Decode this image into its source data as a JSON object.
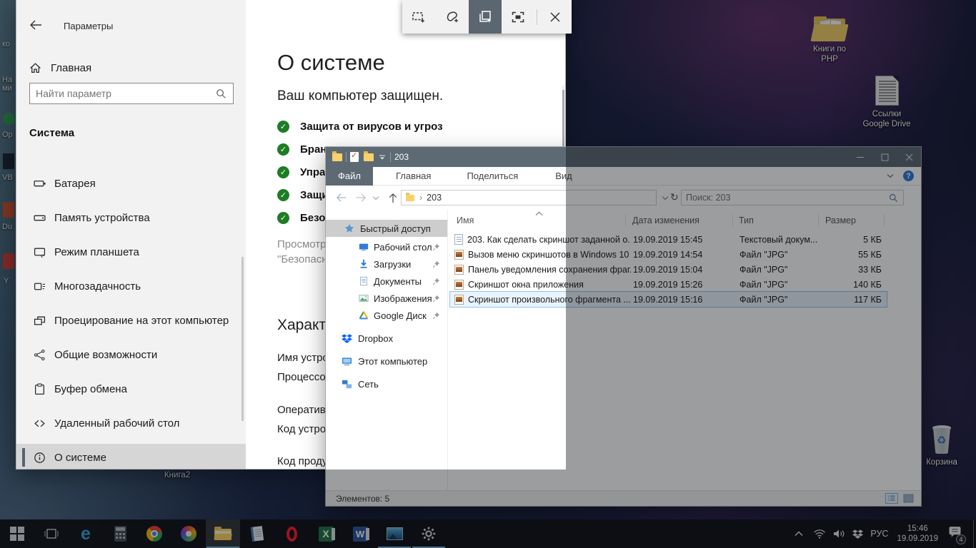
{
  "snip_toolbar": {
    "tools": [
      {
        "name": "rectangular-snip"
      },
      {
        "name": "freeform-snip"
      },
      {
        "name": "window-snip",
        "selected": true
      },
      {
        "name": "fullscreen-snip"
      }
    ]
  },
  "settings": {
    "window_title": "Параметры",
    "home_label": "Главная",
    "search_placeholder": "Найти параметр",
    "section_label": "Система",
    "nav_items": [
      {
        "icon": "battery-icon",
        "label": "Батарея"
      },
      {
        "icon": "storage-icon",
        "label": "Память устройства"
      },
      {
        "icon": "tablet-icon",
        "label": "Режим планшета"
      },
      {
        "icon": "multitasking-icon",
        "label": "Многозадачность"
      },
      {
        "icon": "projecting-icon",
        "label": "Проецирование на этот компьютер"
      },
      {
        "icon": "shared-experiences-icon",
        "label": "Общие возможности"
      },
      {
        "icon": "clipboard-icon",
        "label": "Буфер обмена"
      },
      {
        "icon": "remote-desktop-icon",
        "label": "Удаленный рабочий стол"
      },
      {
        "icon": "info-icon",
        "label": "О системе",
        "selected": true
      }
    ],
    "about": {
      "title": "О системе",
      "protected_line": "Ваш компьютер защищен.",
      "checks": [
        "Защита от вирусов и угроз",
        "Брандмауэр и защита сети",
        "Управление приложениями и браузером",
        "Защита учетных записей",
        "Безопасность устройства"
      ],
      "link_line1": "Просмотреть сведения в приложении",
      "link_line2": "\"Безопасность Windows\"",
      "specs_title": "Характеристики",
      "specs": [
        "Имя устройства",
        "Процессор",
        "Оперативная память",
        "Код устройства",
        "Код продукта"
      ]
    }
  },
  "explorer": {
    "window_title": "203",
    "menu": [
      "Файл",
      "Главная",
      "Поделиться",
      "Вид"
    ],
    "breadcrumb": "203",
    "search_placeholder": "Поиск: 203",
    "nav": {
      "quick_access": "Быстрый доступ",
      "pinned": [
        {
          "icon": "desktop-icon",
          "label": "Рабочий стол"
        },
        {
          "icon": "downloads-icon",
          "label": "Загрузки"
        },
        {
          "icon": "documents-icon",
          "label": "Документы"
        },
        {
          "icon": "pictures-icon",
          "label": "Изображения"
        },
        {
          "icon": "google-drive-icon",
          "label": "Google Диск"
        }
      ],
      "roots": [
        {
          "icon": "dropbox-icon",
          "label": "Dropbox"
        },
        {
          "icon": "this-pc-icon",
          "label": "Этот компьютер"
        },
        {
          "icon": "network-icon",
          "label": "Сеть"
        }
      ]
    },
    "columns": [
      "Имя",
      "Дата изменения",
      "Тип",
      "Размер"
    ],
    "files": [
      {
        "icon": "text-file-icon",
        "name": "203. Как сделать скриншот заданной о...",
        "date": "19.09.2019 15:45",
        "type": "Текстовый докум...",
        "size": "5 КБ"
      },
      {
        "icon": "jpg-file-icon",
        "name": "Вызов меню скриншотов в Windows 10",
        "date": "19.09.2019 14:54",
        "type": "Файл \"JPG\"",
        "size": "55 КБ"
      },
      {
        "icon": "jpg-file-icon",
        "name": "Панель уведомления сохранения фраг...",
        "date": "19.09.2019 15:04",
        "type": "Файл \"JPG\"",
        "size": "33 КБ"
      },
      {
        "icon": "jpg-file-icon",
        "name": "Скриншот окна приложения",
        "date": "19.09.2019 15:26",
        "type": "Файл \"JPG\"",
        "size": "140 КБ"
      },
      {
        "icon": "jpg-file-icon",
        "name": "Скриншот произвольного фрагмента ...",
        "date": "19.09.2019 15:16",
        "type": "Файл \"JPG\"",
        "size": "117 КБ",
        "selected": true
      }
    ],
    "status": "Элементов: 5"
  },
  "desktop": {
    "icons": [
      {
        "icon": "folder-icon",
        "label": "Книги по\nPHP"
      },
      {
        "icon": "document-icon",
        "label": "Ссылки\nGoogle Drive"
      },
      {
        "icon": "recycle-bin-icon",
        "label": "Корзина"
      },
      {
        "icon": "excel-file-icon",
        "label": "Книга2"
      }
    ],
    "edge_labels": [
      "ко",
      "На\nми",
      "Op",
      "VB",
      "Du",
      "Y"
    ]
  },
  "taskbar": {
    "apps": [
      "start",
      "task-view",
      "edge",
      "calculator",
      "chrome",
      "paint",
      "file-explorer",
      "notepad",
      "opera",
      "excel",
      "word",
      "photos",
      "settings"
    ],
    "active_app": "file-explorer",
    "tray": {
      "lang": "РУС",
      "time": "15:46",
      "date": "19.09.2019",
      "notification_count": "4"
    }
  }
}
